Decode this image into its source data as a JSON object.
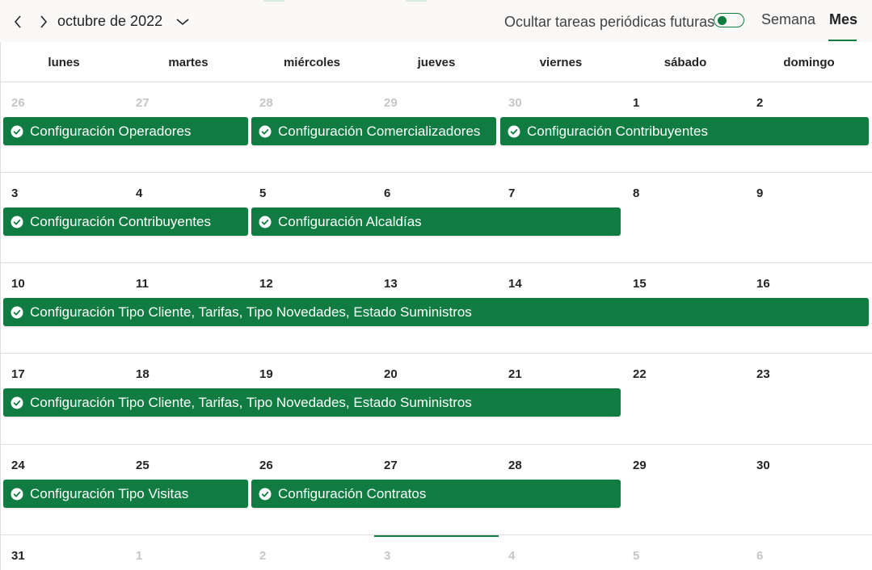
{
  "header": {
    "month_label": "octubre de 2022",
    "prev_icon": "chevron-left-icon",
    "next_icon": "chevron-right-icon",
    "dropdown_icon": "chevron-down-icon",
    "toggle_label": "Ocultar tareas periódicas futuras",
    "toggle_on": true,
    "view_week": "Semana",
    "view_month": "Mes",
    "active_view": "Mes"
  },
  "colors": {
    "accent": "#107c41",
    "muted_text": "#c8c6c4",
    "border": "#e1dfdd"
  },
  "weekdays": [
    "lunes",
    "martes",
    "miércoles",
    "jueves",
    "viernes",
    "sábado",
    "domingo"
  ],
  "weeks": [
    {
      "days": [
        "26",
        "27",
        "28",
        "29",
        "30",
        "1",
        "2"
      ],
      "muted": [
        true,
        true,
        true,
        true,
        true,
        false,
        false
      ],
      "tasks": [
        {
          "label": "Configuración Operadores",
          "start": 0,
          "span": 2
        },
        {
          "label": "Configuración Comercializadores",
          "start": 2,
          "span": 2
        },
        {
          "label": "Configuración Contribuyentes",
          "start": 4,
          "span": 3
        }
      ]
    },
    {
      "days": [
        "3",
        "4",
        "5",
        "6",
        "7",
        "8",
        "9"
      ],
      "muted": [
        false,
        false,
        false,
        false,
        false,
        false,
        false
      ],
      "tasks": [
        {
          "label": "Configuración Contribuyentes",
          "start": 0,
          "span": 2
        },
        {
          "label": "Configuración Alcaldías",
          "start": 2,
          "span": 3
        }
      ]
    },
    {
      "days": [
        "10",
        "11",
        "12",
        "13",
        "14",
        "15",
        "16"
      ],
      "muted": [
        false,
        false,
        false,
        false,
        false,
        false,
        false
      ],
      "tasks": [
        {
          "label": "Configuración Tipo Cliente, Tarifas, Tipo Novedades, Estado Suministros",
          "start": 0,
          "span": 7
        }
      ]
    },
    {
      "days": [
        "17",
        "18",
        "19",
        "20",
        "21",
        "22",
        "23"
      ],
      "muted": [
        false,
        false,
        false,
        false,
        false,
        false,
        false
      ],
      "tasks": [
        {
          "label": "Configuración Tipo Cliente, Tarifas, Tipo Novedades, Estado Suministros",
          "start": 0,
          "span": 5
        }
      ]
    },
    {
      "days": [
        "24",
        "25",
        "26",
        "27",
        "28",
        "29",
        "30"
      ],
      "muted": [
        false,
        false,
        false,
        false,
        false,
        false,
        false
      ],
      "tasks": [
        {
          "label": "Configuración Tipo Visitas",
          "start": 0,
          "span": 2
        },
        {
          "label": "Configuración Contratos",
          "start": 2,
          "span": 3
        }
      ]
    },
    {
      "days": [
        "31",
        "1",
        "2",
        "3",
        "4",
        "5",
        "6"
      ],
      "muted": [
        false,
        true,
        true,
        true,
        true,
        true,
        true
      ],
      "tasks": []
    }
  ],
  "task_icon": "check-circle-icon"
}
